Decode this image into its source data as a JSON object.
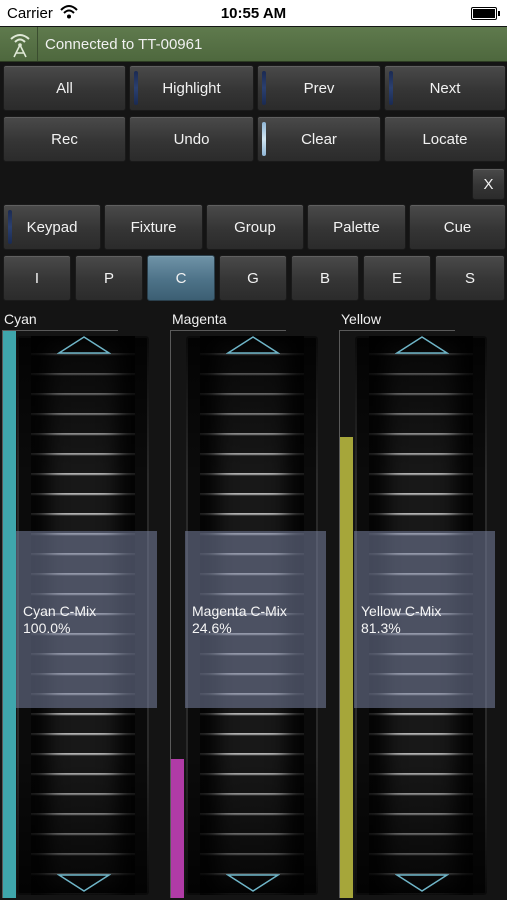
{
  "status_bar": {
    "carrier": "Carrier",
    "time": "10:55 AM"
  },
  "connection": {
    "text": "Connected to TT-00961",
    "icon": "antenna-icon",
    "color": "#56703f"
  },
  "row1": [
    {
      "label": "All",
      "led": "none"
    },
    {
      "label": "Highlight",
      "led": "off"
    },
    {
      "label": "Prev",
      "led": "off"
    },
    {
      "label": "Next",
      "led": "off"
    }
  ],
  "row2": [
    {
      "label": "Rec",
      "led": "none"
    },
    {
      "label": "Undo",
      "led": "none"
    },
    {
      "label": "Clear",
      "led": "on"
    },
    {
      "label": "Locate",
      "led": "none"
    }
  ],
  "close_label": "X",
  "modes": [
    {
      "label": "Keypad",
      "led": "off"
    },
    {
      "label": "Fixture",
      "led": "none"
    },
    {
      "label": "Group",
      "led": "none"
    },
    {
      "label": "Palette",
      "led": "none"
    },
    {
      "label": "Cue",
      "led": "none"
    }
  ],
  "attributes": [
    {
      "label": "I"
    },
    {
      "label": "P"
    },
    {
      "label": "C",
      "selected": true
    },
    {
      "label": "G"
    },
    {
      "label": "B"
    },
    {
      "label": "E"
    },
    {
      "label": "S"
    }
  ],
  "faders": [
    {
      "name": "Cyan",
      "param": "Cyan C-Mix",
      "value": "100.0%",
      "level": 1.0,
      "color": "#3fa6ac"
    },
    {
      "name": "Magenta",
      "param": "Magenta C-Mix",
      "value": "24.6%",
      "level": 0.246,
      "color": "#b03ba6"
    },
    {
      "name": "Yellow",
      "param": "Yellow C-Mix",
      "value": "81.3%",
      "level": 0.813,
      "color": "#a6a63a"
    }
  ]
}
